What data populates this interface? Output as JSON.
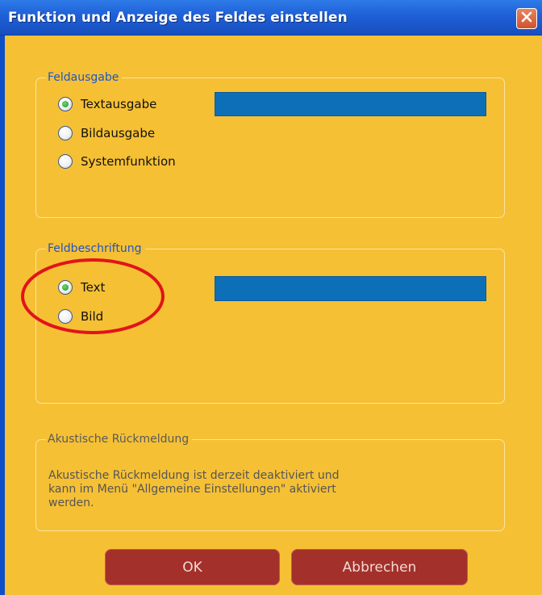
{
  "window": {
    "title": "Funktion und Anzeige des Feldes einstellen"
  },
  "feldausgabe": {
    "legend": "Feldausgabe",
    "options": [
      {
        "label": "Textausgabe",
        "selected": true
      },
      {
        "label": "Bildausgabe",
        "selected": false
      },
      {
        "label": "Systemfunktion",
        "selected": false
      }
    ]
  },
  "feldbeschriftung": {
    "legend": "Feldbeschriftung",
    "options": [
      {
        "label": "Text",
        "selected": true
      },
      {
        "label": "Bild",
        "selected": false
      }
    ]
  },
  "akustik": {
    "legend": "Akustische Rückmeldung",
    "line1": "Akustische Rückmeldung ist derzeit deaktiviert und",
    "line2": "kann im Menü \"Allgemeine Einstellungen\" aktiviert",
    "line3": "werden."
  },
  "buttons": {
    "ok": "OK",
    "cancel": "Abbrechen"
  },
  "colors": {
    "dialog_background": "#f6c034",
    "titlebar": "#1f5fd6",
    "field_blue": "#0d6fb8",
    "button_red": "#a3302a",
    "annotation_red": "#e0141a"
  },
  "icons": {
    "close": "close-icon"
  }
}
